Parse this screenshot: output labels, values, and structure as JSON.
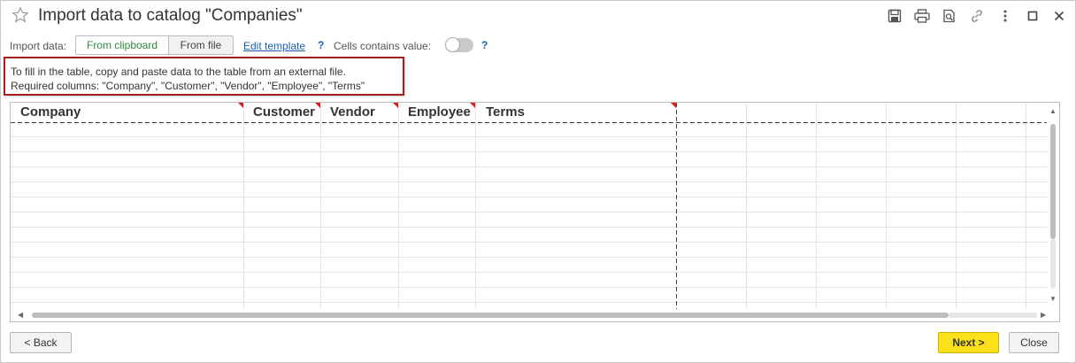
{
  "window": {
    "title": "Import data to catalog \"Companies\""
  },
  "toolbar": {
    "import_label": "Import data:",
    "from_clipboard": "From clipboard",
    "from_file": "From file",
    "edit_template": "Edit template",
    "help": "?",
    "cells_label": "Cells contains value:",
    "cells_toggle_on": false
  },
  "hint": {
    "line1": "To fill in the table, copy and paste data to the table from an external file.",
    "line2": "Required columns: \"Company\", \"Customer\", \"Vendor\", \"Employee\", \"Terms\""
  },
  "sheet": {
    "columns": [
      "Company",
      "Customer",
      "Vendor",
      "Employee",
      "Terms"
    ]
  },
  "footer": {
    "back": "< Back",
    "next": "Next >",
    "close": "Close"
  },
  "colors": {
    "accent_green": "#2e8b3e",
    "link_blue": "#1a5fb4",
    "hint_border": "#a51d1d",
    "required_marker": "#e01b1b",
    "next_button": "#fbe11a"
  },
  "icons": {
    "favorite": "star-icon",
    "save": "save-icon",
    "print": "print-icon",
    "preview": "print-preview-icon",
    "link": "link-icon",
    "more": "more-icon",
    "maximize": "maximize-icon",
    "close": "close-icon"
  }
}
